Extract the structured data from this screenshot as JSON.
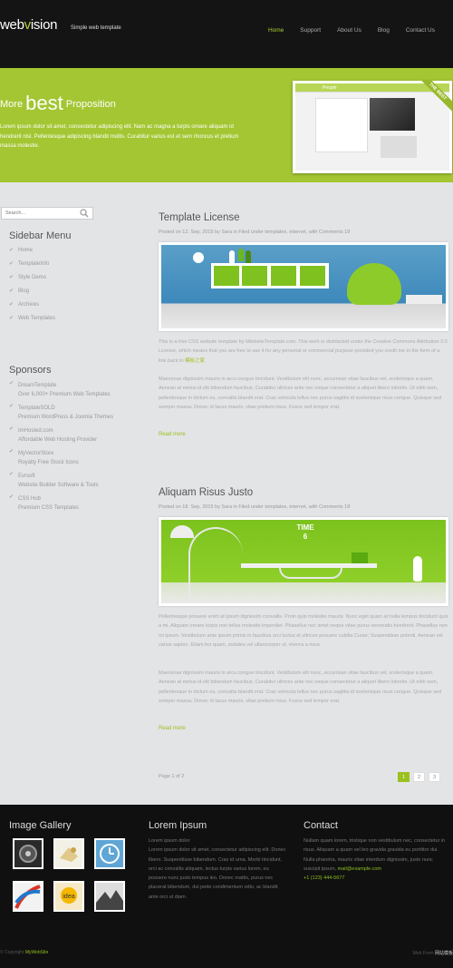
{
  "header": {
    "logo_web": "web",
    "logo_v": "v",
    "logo_rest": "ision",
    "tagline": "Simple web template",
    "nav": [
      "Home",
      "Support",
      "About Us",
      "Blog",
      "Contact Us"
    ]
  },
  "banner": {
    "title_pre": "More",
    "title_big": "best",
    "title_post": "Proposition",
    "text": "Lorem ipsum dolor sit amet, consectetur adipiscing elit. Nam ac magna a turpis ornare aliquam id hendrerit nisl. Pellentesque adipiscing blandit mollis. Curabitur varius est et sem rhoncus et pretium massa molestie.",
    "ribbon": "THE BEST",
    "shot_title": "People"
  },
  "search": {
    "placeholder": "Search..."
  },
  "sidebar": {
    "menu_title": "Sidebar Menu",
    "menu": [
      "Home",
      "TemplateInfo",
      "Style Demo",
      "Blog",
      "Archives",
      "Web Templates"
    ],
    "sponsors_title": "Sponsors",
    "sponsors": [
      {
        "name": "DreamTemplate",
        "desc": "Over 6,000+ Premium Web Templates"
      },
      {
        "name": "TemplateSOLD",
        "desc": "Premium WordPress & Joomla Themes"
      },
      {
        "name": "ImHosted.com",
        "desc": "Affordable Web Hosting Provider"
      },
      {
        "name": "MyVectorStore",
        "desc": "Royalty Free Stock Icons"
      },
      {
        "name": "Evrsoft",
        "desc": "Website Builder Software & Tools"
      },
      {
        "name": "CSS Hub",
        "desc": "Premium CSS Templates"
      }
    ]
  },
  "posts": [
    {
      "title": "Template License",
      "meta": "Posted on 12. Sep, 2015 by Sara in Filed under templates, internet, with Comments 18",
      "p1_pre": "This is a free CSS website template by iWebsiteTemplate.com. This work is distributed under the Creative Commons Attribution 3.0 License, which means that you are free to use it for any personal or commercial purpose provided you credit me in the form of a link back to ",
      "p1_link": "模板之家",
      "p2": "Maecenas dignissim mauris in arcu congue tincidunt. Vestibulum elit nunc, accumsan vitae faucibus vel, scelerisque a quam. Aenean at metus id elit bibendum faucibus. Curabitur ultrices ante nec neque consectetur a aliquet libero lobortis. Ut nibh sem, pellentesque in dictum eu, convallis blandit erat. Cras vehicula tellus nec purus sagittis id scelerisque risus congue. Quisque sed semper massa. Donec id lacus mauris, vitae pretium risus. Fusce sed tempor erat.",
      "read_more": "Read more"
    },
    {
      "title": "Aliquam Risus Justo",
      "meta": "Posted on 18. Sep, 2015 by Sara in Filed under templates, internet, with Comments 18",
      "p1": "Pellentesque posuere enim at ipsum dignissim convallis. Proin quis molestie mauris. Nunc eget quam at nulla tempus tincidunt quis a mi. Aliquam ornare turpis non tellus molestie imperdiet. Phasellus nec amet neque vitae purus venenatis hendrerit. Phasellus non mi ipsum. Vestibulum ante ipsum primis in faucibus orci luctus et ultrices posuere cubilia Curae; Suspendisse potenti. Aenean vel varius sapien. Etiam leo quam, sodales vel ullamcorper ut, viverra a risus.",
      "p2": "Maecenas dignissim mauris in arcu congue tincidunt. Vestibulum elit nunc, accumsan vitae faucibus vel, scelerisque a quam. Aenean at metus id elit bibendum faucibus. Curabitur ultrices ante nec neque consectetur a aliquet libero lobortis. Ut nibh sem, pellentesque in dictum eu, convallis blandit erat. Cras vehicula tellus nec purus sagittis id scelerisque risus congue. Quisque sed semper massa. Donec id lacus mauris, vitae pretium risus. Fusce sed tempor erat.",
      "read_more": "Read more",
      "clock_label": "TIME",
      "clock_num": "6"
    }
  ],
  "pagination": {
    "info": "Page 1 of 2",
    "pages": [
      "1",
      "2",
      "3"
    ]
  },
  "footer": {
    "gallery_title": "Image Gallery",
    "gallery_idea": "idea",
    "lorem_title": "Lorem Ipsum",
    "lorem_sub": "Lorem ipsum dolor",
    "lorem_text": "Lorem ipsum dolor sit amet, consectetur adipiscing elit. Donec libero. Suspendisse bibendum. Cras id urna. Morbi tincidunt, orci ac convallis aliquam, lectus turpis varius lorem, eu posuere nunc justo tempus leo. Donec mattis, purus nec placerat bibendum, dui pede condimentum odio, ac blandit ante orci ut diam.",
    "contact_title": "Contact",
    "contact_text": "Nullam quam lorem, tristique non vestibulum nec, consectetur in risus. Aliquam a quam vel leo gravida gravida eu porttitor dui. Nulla pharetra, mauris vitae interdum dignissim, justo nunc suscipit ipsum,",
    "email": "mail@example.com",
    "phone": "+1 (123) 444-5677",
    "copyright_pre": "© Copyright",
    "copyright_link": "MyWebSite",
    "right_pre": "Web Form",
    "right_link": "网站模板"
  },
  "colors": {
    "accent": "#a3c632",
    "dark": "#141414",
    "bg": "#e3e4e6"
  }
}
